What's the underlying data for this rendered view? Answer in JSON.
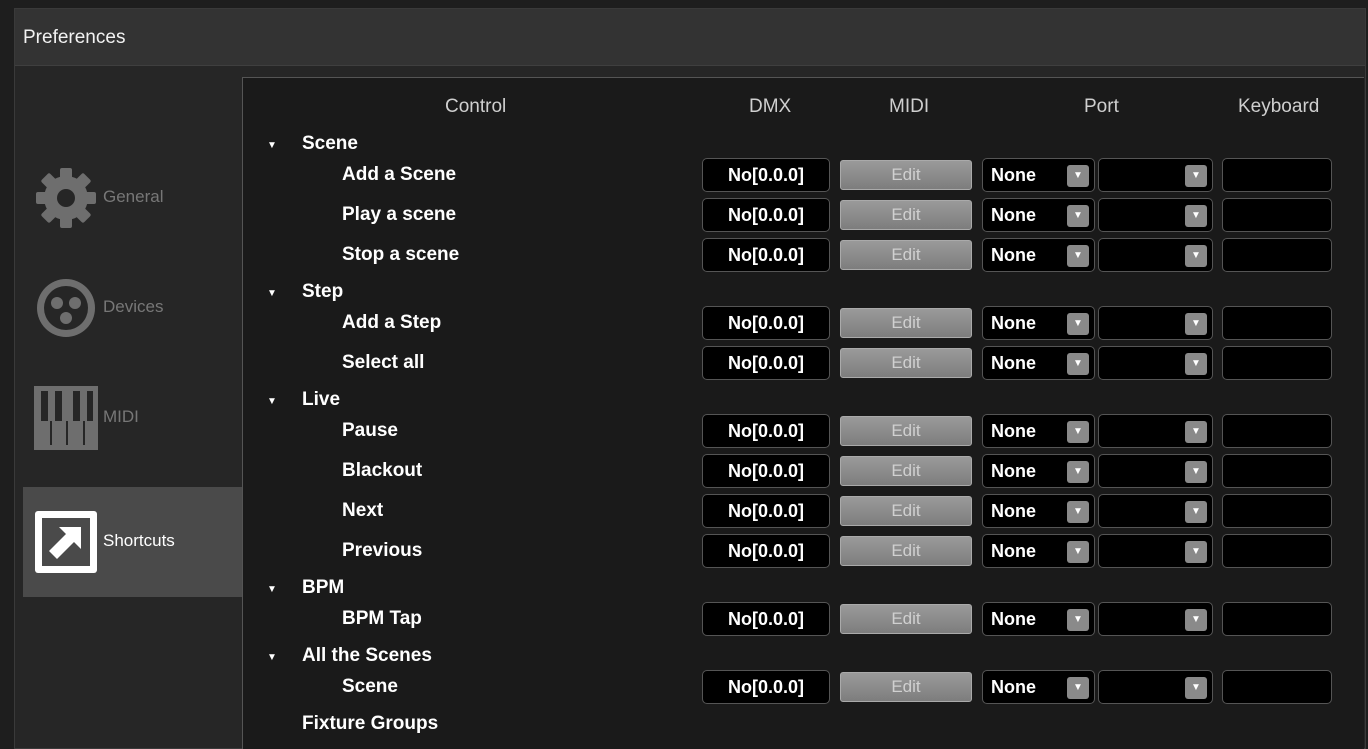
{
  "window": {
    "title": "Preferences"
  },
  "sidebar": {
    "items": [
      {
        "label": "General",
        "icon": "gear-icon",
        "active": false
      },
      {
        "label": "Devices",
        "icon": "dmx-connector-icon",
        "active": false
      },
      {
        "label": "MIDI",
        "icon": "piano-keys-icon",
        "active": false
      },
      {
        "label": "Shortcuts",
        "icon": "shortcut-arrow-icon",
        "active": true
      }
    ]
  },
  "table": {
    "headers": {
      "control": "Control",
      "dmx": "DMX",
      "midi": "MIDI",
      "port": "Port",
      "keyboard": "Keyboard"
    },
    "groups": [
      {
        "label": "Scene",
        "items": [
          {
            "label": "Add a Scene",
            "dmx": "No[0.0.0]",
            "midi": "Edit",
            "port": "None",
            "port2": "",
            "keyboard": ""
          },
          {
            "label": "Play a scene",
            "dmx": "No[0.0.0]",
            "midi": "Edit",
            "port": "None",
            "port2": "",
            "keyboard": ""
          },
          {
            "label": "Stop a scene",
            "dmx": "No[0.0.0]",
            "midi": "Edit",
            "port": "None",
            "port2": "",
            "keyboard": ""
          }
        ]
      },
      {
        "label": "Step",
        "items": [
          {
            "label": "Add a Step",
            "dmx": "No[0.0.0]",
            "midi": "Edit",
            "port": "None",
            "port2": "",
            "keyboard": ""
          },
          {
            "label": "Select all",
            "dmx": "No[0.0.0]",
            "midi": "Edit",
            "port": "None",
            "port2": "",
            "keyboard": ""
          }
        ]
      },
      {
        "label": "Live",
        "items": [
          {
            "label": "Pause",
            "dmx": "No[0.0.0]",
            "midi": "Edit",
            "port": "None",
            "port2": "",
            "keyboard": ""
          },
          {
            "label": "Blackout",
            "dmx": "No[0.0.0]",
            "midi": "Edit",
            "port": "None",
            "port2": "",
            "keyboard": ""
          },
          {
            "label": "Next",
            "dmx": "No[0.0.0]",
            "midi": "Edit",
            "port": "None",
            "port2": "",
            "keyboard": ""
          },
          {
            "label": "Previous",
            "dmx": "No[0.0.0]",
            "midi": "Edit",
            "port": "None",
            "port2": "",
            "keyboard": ""
          }
        ]
      },
      {
        "label": "BPM",
        "items": [
          {
            "label": "BPM Tap",
            "dmx": "No[0.0.0]",
            "midi": "Edit",
            "port": "None",
            "port2": "",
            "keyboard": ""
          }
        ]
      },
      {
        "label": "All the Scenes",
        "items": [
          {
            "label": "Scene",
            "dmx": "No[0.0.0]",
            "midi": "Edit",
            "port": "None",
            "port2": "",
            "keyboard": ""
          }
        ]
      },
      {
        "label": "Fixture Groups",
        "items": []
      }
    ]
  }
}
